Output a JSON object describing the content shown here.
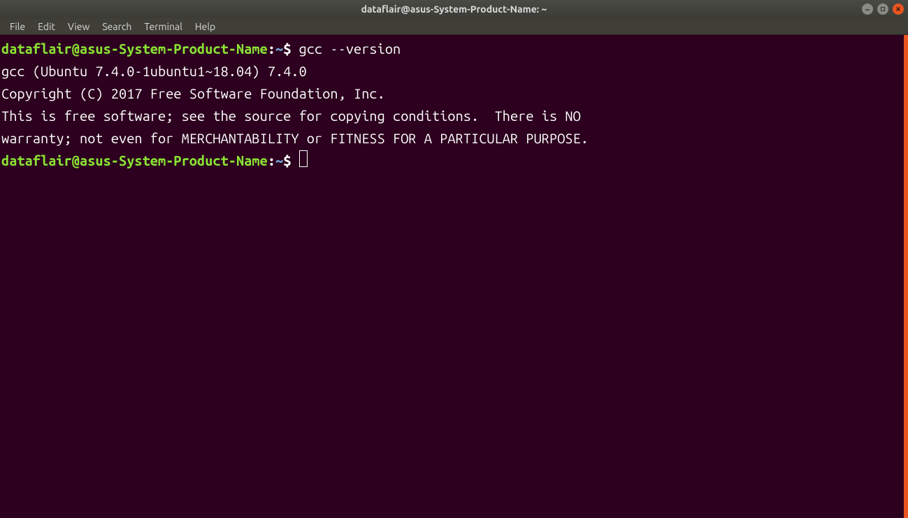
{
  "titlebar": {
    "title": "dataflair@asus-System-Product-Name: ~"
  },
  "menubar": {
    "items": [
      "File",
      "Edit",
      "View",
      "Search",
      "Terminal",
      "Help"
    ]
  },
  "prompt": {
    "user_host": "dataflair@asus-System-Product-Name",
    "colon": ":",
    "path": "~",
    "dollar": "$"
  },
  "session": {
    "command1": "gcc --version",
    "output_lines": [
      "gcc (Ubuntu 7.4.0-1ubuntu1~18.04) 7.4.0",
      "Copyright (C) 2017 Free Software Foundation, Inc.",
      "This is free software; see the source for copying conditions.  There is NO",
      "warranty; not even for MERCHANTABILITY or FITNESS FOR A PARTICULAR PURPOSE.",
      ""
    ]
  }
}
